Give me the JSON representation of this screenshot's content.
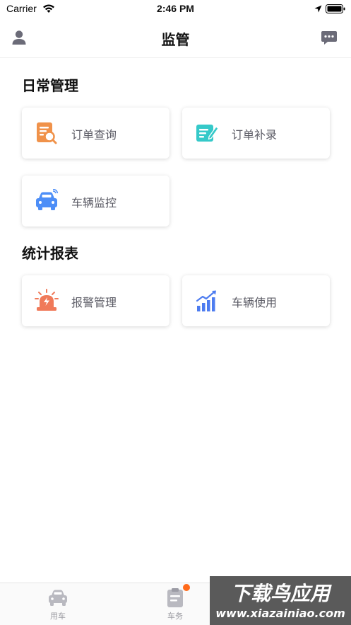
{
  "status_bar": {
    "carrier": "Carrier",
    "time": "2:46 PM"
  },
  "nav": {
    "title": "监管",
    "left_icon": "user-icon",
    "right_icon": "chat-icon"
  },
  "sections": [
    {
      "title": "日常管理",
      "cards": [
        {
          "label": "订单查询",
          "icon": "order-search-icon",
          "color": "#f0924a"
        },
        {
          "label": "订单补录",
          "icon": "order-supplement-icon",
          "color": "#35c9c9"
        },
        {
          "label": "车辆监控",
          "icon": "car-monitor-icon",
          "color": "#4d8ef7"
        }
      ]
    },
    {
      "title": "统计报表",
      "cards": [
        {
          "label": "报警管理",
          "icon": "alarm-icon",
          "color": "#f07a5a"
        },
        {
          "label": "车辆使用",
          "icon": "vehicle-usage-chart-icon",
          "color": "#4d7cf0"
        }
      ]
    }
  ],
  "tab_bar": {
    "tabs": [
      {
        "label": "用车",
        "icon": "car-icon"
      },
      {
        "label": "车务",
        "icon": "clipboard-icon",
        "badge": true
      }
    ],
    "badge_color": "#ff6a1a"
  },
  "watermark": {
    "line1": "下载鸟应用",
    "line2": "www.xiazainiao.com"
  }
}
